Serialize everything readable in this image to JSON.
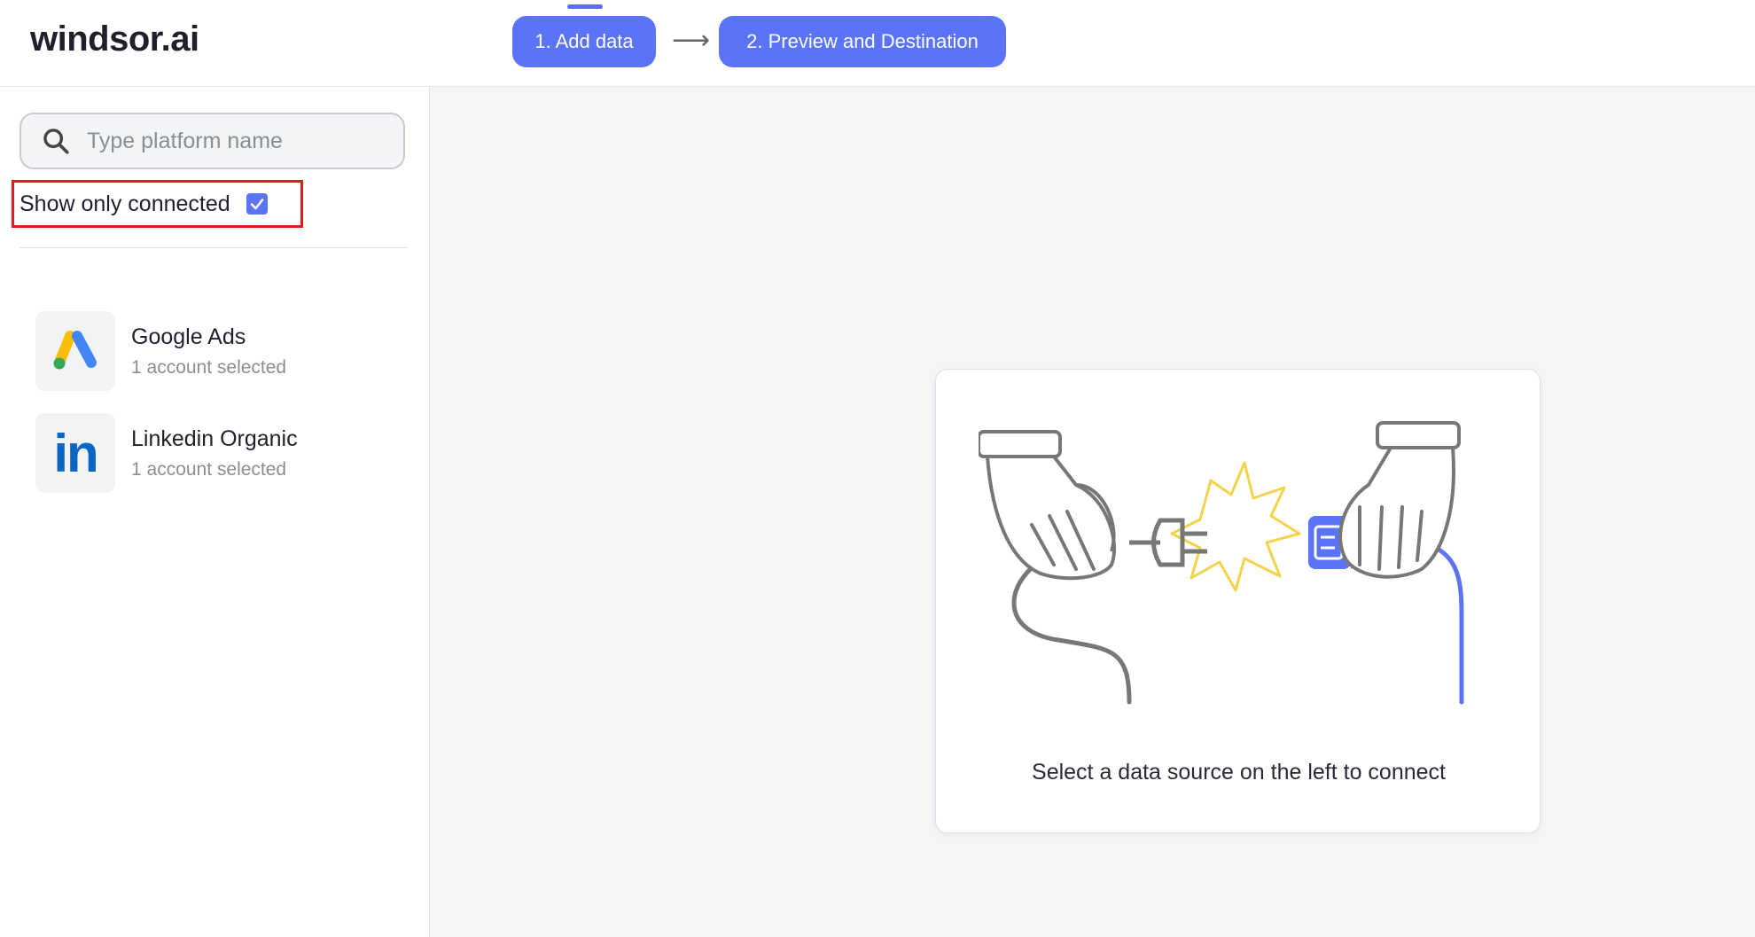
{
  "header": {
    "logo": "windsor.ai",
    "steps": [
      {
        "label": "1. Add data"
      },
      {
        "label": "2. Preview and Destination"
      }
    ],
    "arrow": "⟶"
  },
  "sidebar": {
    "search": {
      "placeholder": "Type platform name",
      "value": ""
    },
    "filter": {
      "label": "Show only connected",
      "checked": true
    },
    "sources": [
      {
        "name": "Google Ads",
        "status": "1 account selected",
        "icon": "google-ads-icon"
      },
      {
        "name": "Linkedin Organic",
        "status": "1 account selected",
        "icon": "linkedin-icon",
        "logo_text": "in"
      }
    ]
  },
  "main": {
    "empty_state": {
      "caption": "Select a data source on the left to connect",
      "icon": "plug-connect-illustration"
    }
  },
  "colors": {
    "accent": "#5b73f6",
    "highlight_border": "#e01b1b",
    "main_bg": "#f5f5f7"
  }
}
